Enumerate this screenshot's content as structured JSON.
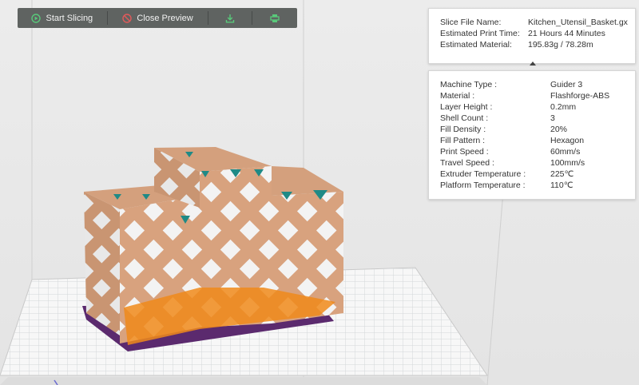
{
  "toolbar": {
    "start_slicing": "Start Slicing",
    "close_preview": "Close Preview"
  },
  "file_info": {
    "rows": [
      {
        "label": "Slice File Name:",
        "value": "Kitchen_Utensil_Basket.gx"
      },
      {
        "label": "Estimated Print Time:",
        "value": "21 Hours 44 Minutes"
      },
      {
        "label": "Estimated Material:",
        "value": "195.83g / 78.28m"
      }
    ]
  },
  "print_settings": {
    "rows": [
      {
        "label": "Machine Type :",
        "value": "Guider 3"
      },
      {
        "label": "Material :",
        "value": "Flashforge-ABS"
      },
      {
        "label": "Layer Height :",
        "value": "0.2mm"
      },
      {
        "label": "Shell Count :",
        "value": "3"
      },
      {
        "label": "Fill Density :",
        "value": "20%"
      },
      {
        "label": "Fill Pattern :",
        "value": "Hexagon"
      },
      {
        "label": "Print Speed :",
        "value": "60mm/s"
      },
      {
        "label": "Travel Speed :",
        "value": "100mm/s"
      },
      {
        "label": "Extruder Temperature :",
        "value": "225℃"
      },
      {
        "label": "Platform Temperature :",
        "value": "110℃"
      }
    ]
  },
  "colors": {
    "toolbar_bg": "#5f6361",
    "accent_green": "#58c97a",
    "close_red": "#e05a5a",
    "model_tan": "#d8a27e",
    "infill_orange": "#f08a1a",
    "teal_top": "#1f8a86",
    "raft_purple": "#5b2a6e"
  },
  "icons": {
    "start": "play-circle-icon",
    "close": "no-entry-icon",
    "export": "download-icon",
    "print": "printer-icon"
  }
}
